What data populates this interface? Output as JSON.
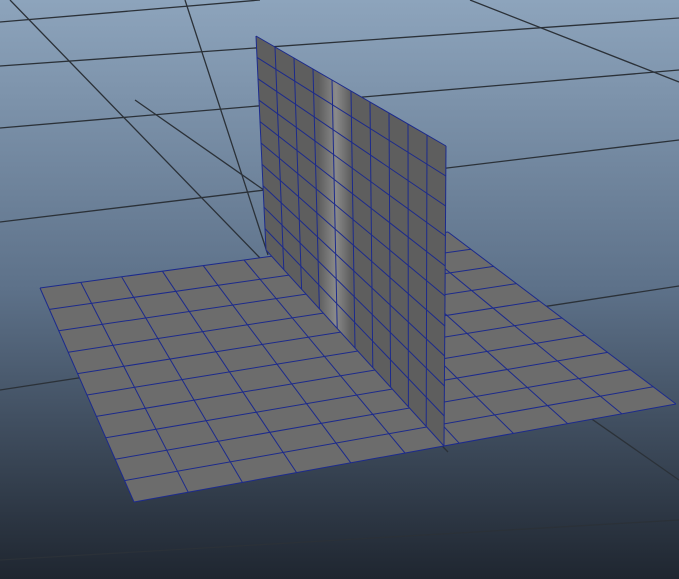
{
  "viewport": {
    "background": {
      "top": "#8da4bc",
      "mid": "#5d7189",
      "bottom": "#1f2630"
    },
    "grid_line_color": "#2b3138",
    "mesh": {
      "wire_color": "#1c2a8c",
      "floor_color": "#6c6c6c",
      "floor_divisions": [
        10,
        10
      ],
      "wall_divisions": [
        10,
        10
      ],
      "wall_color": "#5e5e5e",
      "wall_highlight": "#8a8a8a"
    }
  }
}
